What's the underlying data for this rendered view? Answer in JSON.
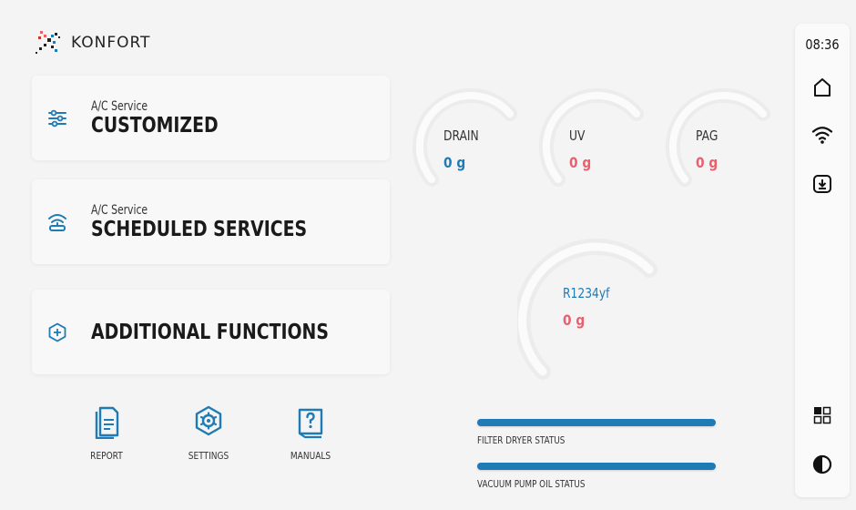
{
  "brand": {
    "name": "KONFORT"
  },
  "status_bar": {
    "time": "08:36"
  },
  "menu": [
    {
      "subtitle": "A/C Service",
      "title": "CUSTOMIZED",
      "icon": "sliders-icon"
    },
    {
      "subtitle": "A/C Service",
      "title": "SCHEDULED SERVICES",
      "icon": "scheduled-antenna-icon"
    },
    {
      "subtitle": "",
      "title": "ADDITIONAL FUNCTIONS",
      "icon": "hexagon-plus-icon"
    }
  ],
  "tools": [
    {
      "label": "REPORT",
      "icon": "report-document-icon"
    },
    {
      "label": "SETTINGS",
      "icon": "settings-gear-icon"
    },
    {
      "label": "MANUALS",
      "icon": "manual-book-icon"
    }
  ],
  "gauges": [
    {
      "name": "DRAIN",
      "value": "0 g",
      "color": "#1f7bb6"
    },
    {
      "name": "UV",
      "value": "0 g",
      "color": "#e8606d"
    },
    {
      "name": "PAG",
      "value": "0 g",
      "color": "#e8606d"
    },
    {
      "name": "R1234yf",
      "value": "0 g",
      "color": "#e8606d",
      "name_color": "#1f7bb6"
    }
  ],
  "status": [
    {
      "label": "FILTER DRYER STATUS",
      "level": 1.0
    },
    {
      "label": "VACUUM PUMP OIL STATUS",
      "level": 1.0
    }
  ],
  "colors": {
    "accent": "#1f7bb6",
    "alert": "#e8606d",
    "background": "#f4f4f4"
  },
  "side_icons": [
    "home-icon",
    "wifi-icon",
    "download-icon",
    "apps-grid-icon",
    "contrast-icon"
  ]
}
